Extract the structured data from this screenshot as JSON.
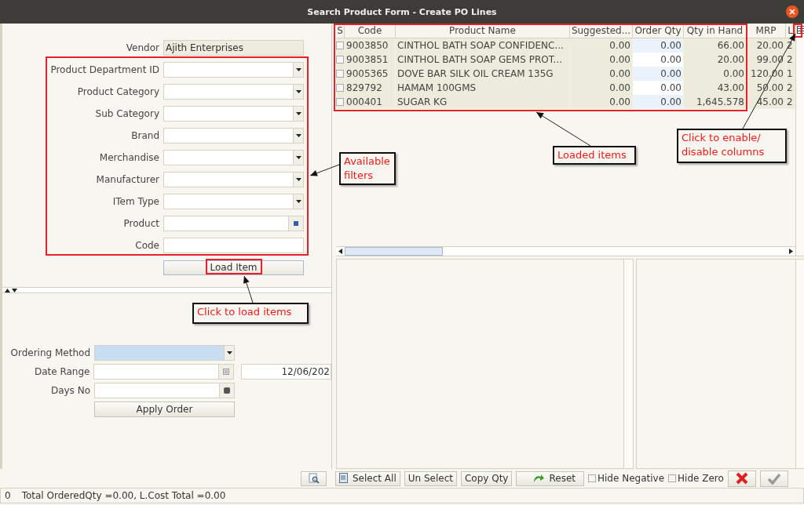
{
  "window": {
    "title": "Search Product Form - Create PO Lines"
  },
  "filters": {
    "vendor": {
      "label": "Vendor",
      "value": "Ajith Enterprises"
    },
    "fields": [
      {
        "label": "Product Department ID",
        "kind": "combo"
      },
      {
        "label": "Product Category",
        "kind": "combo"
      },
      {
        "label": "Sub Category",
        "kind": "combo"
      },
      {
        "label": "Brand",
        "kind": "combo"
      },
      {
        "label": "Merchandise",
        "kind": "combo"
      },
      {
        "label": "Manufacturer",
        "kind": "combo"
      },
      {
        "label": "ITem Type",
        "kind": "combo"
      },
      {
        "label": "Product",
        "kind": "lookup"
      },
      {
        "label": "Code",
        "kind": "text"
      }
    ],
    "load_button": "Load Item"
  },
  "ordering": {
    "fields": [
      {
        "label": "Ordering Method",
        "kind": "combo"
      },
      {
        "label": "Date Range",
        "kind": "date",
        "end_value": "12/06/202"
      },
      {
        "label": "Days No",
        "kind": "spin"
      }
    ],
    "apply_button": "Apply Order"
  },
  "table": {
    "columns": [
      "S",
      "Code",
      "Product Name",
      "Suggested...",
      "Order Qty",
      "Qty in Hand",
      "MRP",
      "L"
    ],
    "rows": [
      {
        "checked": false,
        "cells": [
          "",
          "9003850",
          "CINTHOL BATH SOAP CONFIDENC...",
          "0.00",
          "0.00",
          "66.00",
          "20.00",
          "2"
        ]
      },
      {
        "checked": false,
        "cells": [
          "",
          "9003851",
          "CINTHOL BATH SOAP GEMS PROT...",
          "0.00",
          "0.00",
          "20.00",
          "99.00",
          "2"
        ]
      },
      {
        "checked": false,
        "cells": [
          "",
          "9005365",
          "DOVE  BAR SILK OIL CREAM  135G",
          "0.00",
          "0.00",
          "0.00",
          "120.00",
          "1"
        ]
      },
      {
        "checked": false,
        "cells": [
          "",
          "829792",
          "HAMAM 100GMS",
          "0.00",
          "0.00",
          "43.00",
          "50.00",
          "2"
        ]
      },
      {
        "checked": false,
        "cells": [
          "",
          "000401",
          "SUGAR KG",
          "0.00",
          "0.00",
          "1,645.578",
          "45.00",
          "2"
        ]
      }
    ]
  },
  "toolbar": {
    "buttons": [
      {
        "kind": "preview"
      },
      {
        "kind": "select_all",
        "label": "Select All"
      },
      {
        "kind": "plain",
        "label": "Un Select"
      },
      {
        "kind": "plain",
        "label": "Copy Qty"
      },
      {
        "kind": "reset",
        "label": "Reset"
      }
    ],
    "checkboxes": [
      {
        "label": "Hide Negative",
        "checked": false
      },
      {
        "label": "Hide Zero",
        "checked": false
      }
    ],
    "actions": [
      {
        "kind": "cancel"
      },
      {
        "kind": "ok"
      }
    ]
  },
  "status_bar": {
    "count": "0",
    "text": "Total OrderedQty =0.00, L.Cost Total =0.00"
  },
  "annotations": [
    {
      "text": "Available filters"
    },
    {
      "text": "Loaded items"
    },
    {
      "text": "Click to enable/ disable  columns"
    },
    {
      "text": "Click to load items"
    }
  ]
}
